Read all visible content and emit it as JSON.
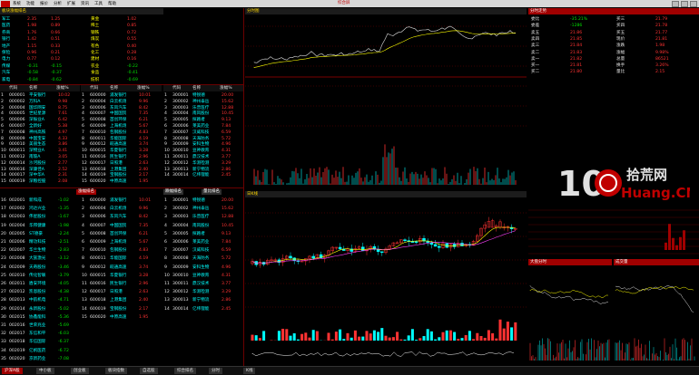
{
  "menu": {
    "items": [
      "系统",
      "功能",
      "报价",
      "分析",
      "扩展",
      "资讯",
      "工具",
      "帮助"
    ],
    "center_title": "综合屏",
    "sector_panel_title": "板块指数"
  },
  "sector_panel": {
    "title": "板块涨幅排名",
    "rows": [
      {
        "name": "军工",
        "v1": "2.35",
        "v2": "1.25",
        "name2": "黄金",
        "v3": "1.02"
      },
      {
        "name": "医药",
        "v1": "1.98",
        "v2": "0.89",
        "name2": "稀土",
        "v3": "0.85"
      },
      {
        "name": "券商",
        "v1": "1.76",
        "v2": "0.66",
        "name2": "钢铁",
        "v3": "0.72"
      },
      {
        "name": "银行",
        "v1": "1.42",
        "v2": "0.51",
        "name2": "煤炭",
        "v3": "0.55"
      },
      {
        "name": "地产",
        "v1": "1.15",
        "v2": "0.33",
        "name2": "有色",
        "v3": "0.40"
      },
      {
        "name": "保险",
        "v1": "0.96",
        "v2": "0.21",
        "name2": "化工",
        "v3": "0.28"
      },
      {
        "name": "电力",
        "v1": "0.77",
        "v2": "0.12",
        "name2": "建材",
        "v3": "0.16"
      },
      {
        "name": "传媒",
        "v1": "-0.31",
        "v2": "-0.15",
        "name2": "农业",
        "v3": "-0.22"
      },
      {
        "name": "汽车",
        "v1": "-0.58",
        "v2": "-0.37",
        "name2": "食品",
        "v3": "-0.41"
      },
      {
        "name": "家电",
        "v1": "-0.84",
        "v2": "-0.62",
        "name2": "纺织",
        "v3": "-0.69"
      }
    ]
  },
  "list_headers": {
    "code": "代码",
    "name": "名称",
    "change": "涨幅%",
    "price": "现价"
  },
  "list1": [
    {
      "i": "1",
      "code": "000001",
      "name": "平安银行",
      "chg": "10.02"
    },
    {
      "i": "2",
      "code": "000002",
      "name": "万科A",
      "chg": "9.98"
    },
    {
      "i": "3",
      "code": "000004",
      "name": "国华网安",
      "chg": "8.75"
    },
    {
      "i": "4",
      "code": "000005",
      "name": "世纪星源",
      "chg": "7.61"
    },
    {
      "i": "5",
      "code": "000006",
      "name": "深振业A",
      "chg": "6.42"
    },
    {
      "i": "6",
      "code": "000007",
      "name": "全新好",
      "chg": "5.38"
    },
    {
      "i": "7",
      "code": "000008",
      "name": "神州高铁",
      "chg": "4.97"
    },
    {
      "i": "8",
      "code": "000009",
      "name": "中国宝安",
      "chg": "4.33"
    },
    {
      "i": "9",
      "code": "000010",
      "name": "美丽生态",
      "chg": "3.86"
    },
    {
      "i": "10",
      "code": "000011",
      "name": "深物业A",
      "chg": "3.41"
    },
    {
      "i": "11",
      "code": "000012",
      "name": "南玻A",
      "chg": "3.05"
    },
    {
      "i": "12",
      "code": "000014",
      "name": "沙河股份",
      "chg": "2.77"
    },
    {
      "i": "13",
      "code": "000016",
      "name": "深康佳A",
      "chg": "2.52"
    },
    {
      "i": "14",
      "code": "000017",
      "name": "深中华A",
      "chg": "2.31"
    },
    {
      "i": "15",
      "code": "000019",
      "name": "深粮控股",
      "chg": "2.08"
    }
  ],
  "list2": [
    {
      "i": "1",
      "code": "600000",
      "name": "浦发银行",
      "chg": "10.01"
    },
    {
      "i": "2",
      "code": "600004",
      "name": "白云机场",
      "chg": "9.96"
    },
    {
      "i": "3",
      "code": "600006",
      "name": "东风汽车",
      "chg": "8.42"
    },
    {
      "i": "4",
      "code": "600007",
      "name": "中国国贸",
      "chg": "7.35"
    },
    {
      "i": "5",
      "code": "600008",
      "name": "首创环保",
      "chg": "6.21"
    },
    {
      "i": "6",
      "code": "600009",
      "name": "上海机场",
      "chg": "5.67"
    },
    {
      "i": "7",
      "code": "600010",
      "name": "包钢股份",
      "chg": "4.83"
    },
    {
      "i": "8",
      "code": "600011",
      "name": "华能国际",
      "chg": "4.19"
    },
    {
      "i": "9",
      "code": "600012",
      "name": "皖通高速",
      "chg": "3.74"
    },
    {
      "i": "10",
      "code": "600015",
      "name": "华夏银行",
      "chg": "3.28"
    },
    {
      "i": "11",
      "code": "600016",
      "name": "民生银行",
      "chg": "2.96"
    },
    {
      "i": "12",
      "code": "600017",
      "name": "日照港",
      "chg": "2.63"
    },
    {
      "i": "13",
      "code": "600018",
      "name": "上港集团",
      "chg": "2.40"
    },
    {
      "i": "14",
      "code": "600019",
      "name": "宝钢股份",
      "chg": "2.17"
    },
    {
      "i": "15",
      "code": "600020",
      "name": "中原高速",
      "chg": "1.95"
    }
  ],
  "list3": [
    {
      "i": "1",
      "code": "300001",
      "name": "特锐德",
      "chg": "20.00"
    },
    {
      "i": "2",
      "code": "300002",
      "name": "神州泰岳",
      "chg": "15.62"
    },
    {
      "i": "3",
      "code": "300003",
      "name": "乐普医疗",
      "chg": "12.88"
    },
    {
      "i": "4",
      "code": "300004",
      "name": "南风股份",
      "chg": "10.45"
    },
    {
      "i": "5",
      "code": "300005",
      "name": "探路者",
      "chg": "9.13"
    },
    {
      "i": "6",
      "code": "300006",
      "name": "莱美药业",
      "chg": "7.84"
    },
    {
      "i": "7",
      "code": "300007",
      "name": "汉威科技",
      "chg": "6.59"
    },
    {
      "i": "8",
      "code": "300008",
      "name": "天海防务",
      "chg": "5.72"
    },
    {
      "i": "9",
      "code": "300009",
      "name": "安科生物",
      "chg": "4.96"
    },
    {
      "i": "10",
      "code": "300010",
      "name": "豆神教育",
      "chg": "4.31"
    },
    {
      "i": "11",
      "code": "300011",
      "name": "鼎汉技术",
      "chg": "3.77"
    },
    {
      "i": "12",
      "code": "300012",
      "name": "华测检测",
      "chg": "3.29"
    },
    {
      "i": "13",
      "code": "300013",
      "name": "新宁物流",
      "chg": "2.86"
    },
    {
      "i": "14",
      "code": "300014",
      "name": "亿纬锂能",
      "chg": "2.45"
    }
  ],
  "lower_tabs": {
    "t1": "涨幅排名",
    "t2": "跌幅排名",
    "t3": "量比排名"
  },
  "lower_list": [
    {
      "i": "16",
      "code": "002001",
      "name": "新和成",
      "chg": "-1.02"
    },
    {
      "i": "17",
      "code": "002002",
      "name": "鸿达兴业",
      "chg": "-1.35"
    },
    {
      "i": "18",
      "code": "002003",
      "name": "伟星股份",
      "chg": "-1.67"
    },
    {
      "i": "19",
      "code": "002004",
      "name": "华邦健康",
      "chg": "-1.98"
    },
    {
      "i": "20",
      "code": "002005",
      "name": "ST德豪",
      "chg": "-2.24"
    },
    {
      "i": "21",
      "code": "002006",
      "name": "精功科技",
      "chg": "-2.51"
    },
    {
      "i": "22",
      "code": "002007",
      "name": "华兰生物",
      "chg": "-2.83"
    },
    {
      "i": "23",
      "code": "002008",
      "name": "大族激光",
      "chg": "-3.12"
    },
    {
      "i": "24",
      "code": "002009",
      "name": "天奇股份",
      "chg": "-3.46"
    },
    {
      "i": "25",
      "code": "002010",
      "name": "传化智联",
      "chg": "-3.79"
    },
    {
      "i": "26",
      "code": "002011",
      "name": "盾安环境",
      "chg": "-4.05"
    },
    {
      "i": "27",
      "code": "002012",
      "name": "凯恩股份",
      "chg": "-4.38"
    },
    {
      "i": "28",
      "code": "002013",
      "name": "中航机电",
      "chg": "-4.71"
    },
    {
      "i": "29",
      "code": "002014",
      "name": "永新股份",
      "chg": "-5.02"
    },
    {
      "i": "30",
      "code": "002015",
      "name": "协鑫能科",
      "chg": "-5.36"
    },
    {
      "i": "31",
      "code": "002016",
      "name": "世荣兆业",
      "chg": "-5.69"
    },
    {
      "i": "32",
      "code": "002017",
      "name": "东信和平",
      "chg": "-6.03"
    },
    {
      "i": "33",
      "code": "002018",
      "name": "华信国际",
      "chg": "-6.37"
    },
    {
      "i": "34",
      "code": "002019",
      "name": "亿帆医药",
      "chg": "-6.72"
    },
    {
      "i": "35",
      "code": "002020",
      "name": "京新药业",
      "chg": "-7.08"
    }
  ],
  "quote_panel": {
    "title": "分时走势",
    "fields": [
      {
        "k": "委比",
        "v": "-35.21%"
      },
      {
        "k": "委差",
        "v": "-1286"
      },
      {
        "k": "卖五",
        "v": "21.86"
      },
      {
        "k": "卖四",
        "v": "21.85"
      },
      {
        "k": "卖三",
        "v": "21.84"
      },
      {
        "k": "卖二",
        "v": "21.83"
      },
      {
        "k": "卖一",
        "v": "21.82"
      },
      {
        "k": "买一",
        "v": "21.81"
      },
      {
        "k": "买二",
        "v": "21.80"
      },
      {
        "k": "买三",
        "v": "21.79"
      },
      {
        "k": "买四",
        "v": "21.78"
      },
      {
        "k": "买五",
        "v": "21.77"
      },
      {
        "k": "现价",
        "v": "21.81"
      },
      {
        "k": "涨跌",
        "v": "1.98"
      },
      {
        "k": "涨幅",
        "v": "9.98%"
      },
      {
        "k": "总量",
        "v": "86521"
      },
      {
        "k": "换手",
        "v": "3.26%"
      },
      {
        "k": "量比",
        "v": "2.15"
      }
    ]
  },
  "watermark": {
    "num": "10",
    "cn": "拾荒网",
    "en": "Huang.CN"
  },
  "bottom_tabs": [
    "沪深A股",
    "中小板",
    "创业板",
    "板块指数",
    "自选股",
    "综合排名",
    "分时",
    "K线"
  ],
  "charts": {
    "intraday_title": "分时图",
    "kline_title": "日K线",
    "small1_title": "大盘分时",
    "small2_title": "成交量"
  }
}
